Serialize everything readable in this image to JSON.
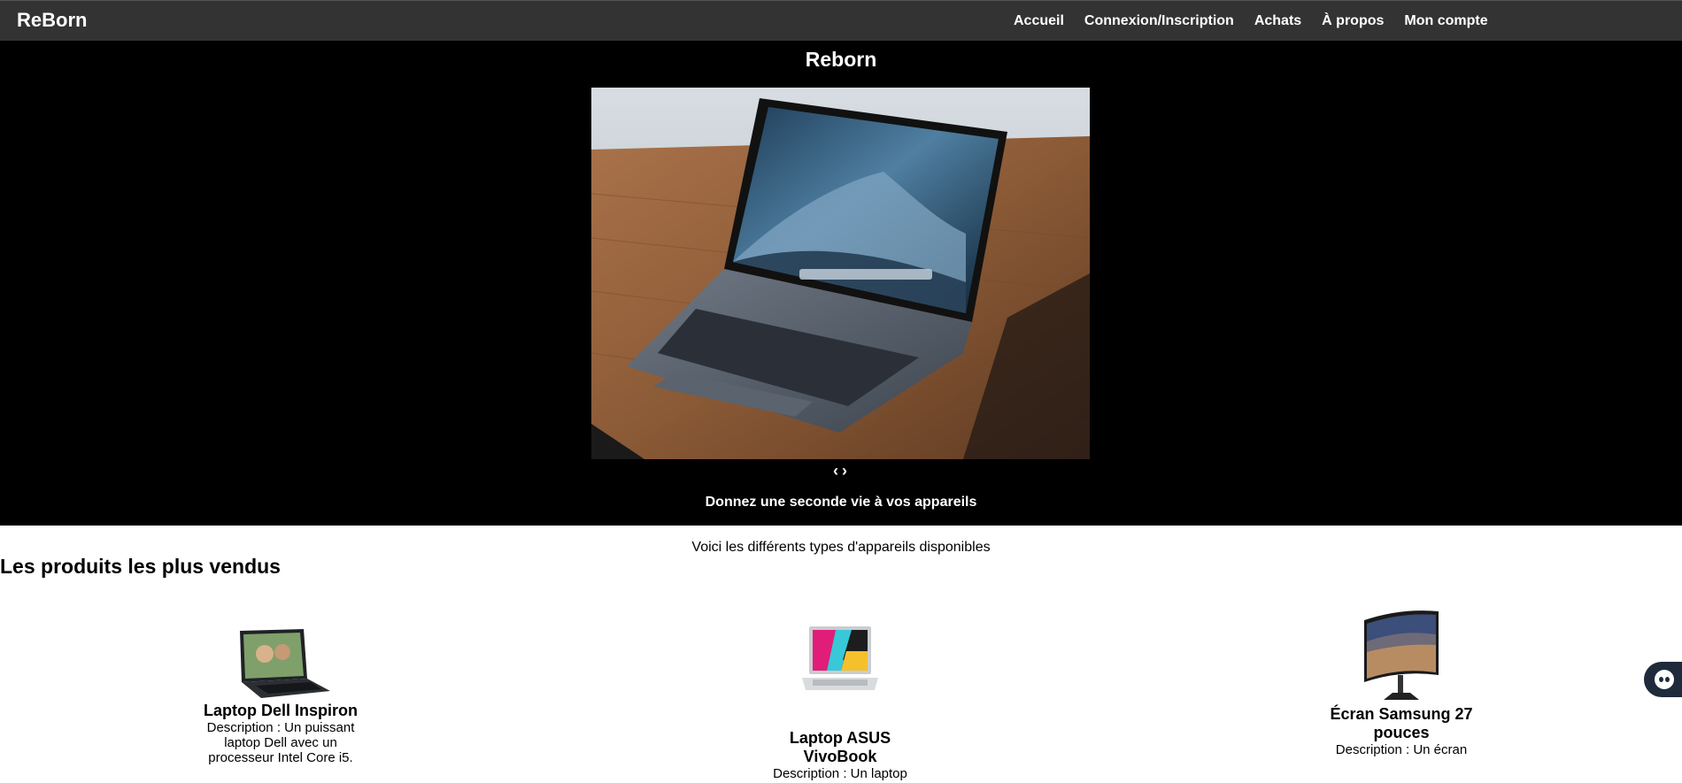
{
  "nav": {
    "brand": "ReBorn",
    "links": [
      {
        "label": "Accueil"
      },
      {
        "label": "Connexion/Inscription"
      },
      {
        "label": "Achats"
      },
      {
        "label": "À propos"
      },
      {
        "label": "Mon compte"
      }
    ]
  },
  "hero": {
    "title": "Reborn",
    "prev": "‹",
    "next": "›",
    "tagline": "Donnez une seconde vie à vos appareils"
  },
  "main": {
    "intro": "Voici les différents types d'appareils disponibles",
    "section_title": "Les produits les plus vendus",
    "products": [
      {
        "name": "Laptop Dell Inspiron",
        "description": "Description : Un puissant laptop Dell avec un processeur Intel Core i5."
      },
      {
        "name": "Laptop ASUS VivoBook",
        "description": "Description : Un laptop"
      },
      {
        "name": "Écran Samsung 27 pouces",
        "description": "Description : Un écran"
      }
    ]
  },
  "colors": {
    "navbar": "#333333",
    "hero_bg": "#000000",
    "chat_widget": "#1f2a3a"
  }
}
